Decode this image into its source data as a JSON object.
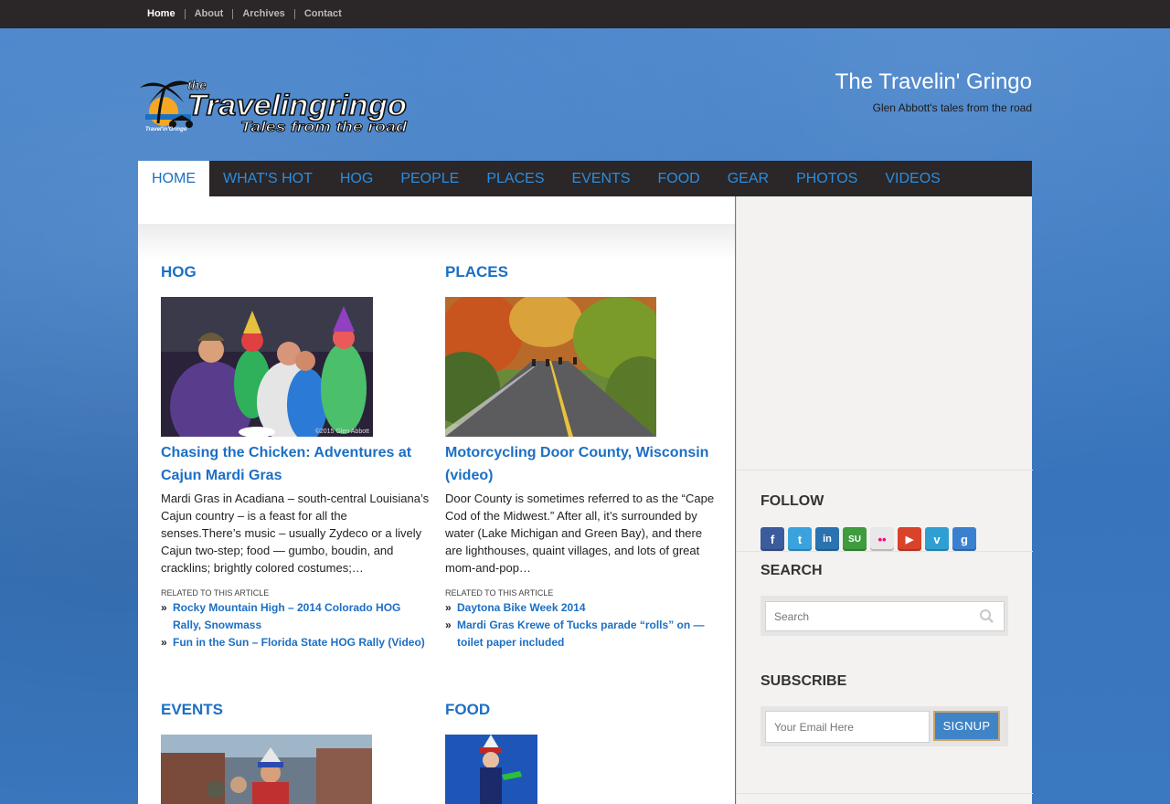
{
  "topnav": {
    "items": [
      {
        "label": "Home",
        "active": true
      },
      {
        "label": "About"
      },
      {
        "label": "Archives"
      },
      {
        "label": "Contact"
      }
    ]
  },
  "header": {
    "logo_text": "the Travelingringo Tales from the road",
    "title": "The Travelin' Gringo",
    "tagline": "Glen Abbott's tales from the road"
  },
  "mainnav": {
    "items": [
      "HOME",
      "WHAT'S HOT",
      "HOG",
      "PEOPLE",
      "PLACES",
      "EVENTS",
      "FOOD",
      "GEAR",
      "PHOTOS",
      "VIDEOS"
    ]
  },
  "sections": [
    {
      "category": "HOG",
      "post_title": "Chasing the Chicken: Adventures at Cajun Mardi Gras",
      "excerpt": "Mardi Gras in Acadiana – south-central Louisiana’s Cajun country – is a feast for all the senses.There’s music – usually Zydeco or a lively Cajun two-step; food — gumbo, boudin, and cracklins; brightly colored costumes;…",
      "image_caption": "©2015 Glen Abbott",
      "related_label": "RELATED TO THIS ARTICLE",
      "related": [
        "Rocky Mountain High – 2014 Colorado HOG Rally, Snowmass",
        "Fun in the Sun – Florida State HOG Rally (Video)"
      ]
    },
    {
      "category": "PLACES",
      "post_title": "Motorcycling Door County, Wisconsin (video)",
      "excerpt": "Door County is sometimes referred to as the “Cape Cod of the Midwest.” After all, it’s surrounded by water (Lake Michigan and Green Bay), and there are lighthouses, quaint villages, and lots of great mom-and-pop…",
      "related_label": "RELATED TO THIS ARTICLE",
      "related": [
        "Daytona Bike Week 2014",
        "Mardi Gras Krewe of Tucks parade “rolls” on — toilet paper included"
      ]
    },
    {
      "category": "EVENTS"
    },
    {
      "category": "FOOD"
    }
  ],
  "sidebar": {
    "follow_heading": "FOLLOW",
    "social": [
      {
        "icon": "facebook-icon",
        "glyph": "f",
        "color": "#3b5b9c"
      },
      {
        "icon": "twitter-icon",
        "glyph": "t",
        "color": "#3aa2dc"
      },
      {
        "icon": "linkedin-icon",
        "glyph": "in",
        "color": "#2a73b0"
      },
      {
        "icon": "stumbleupon-icon",
        "glyph": "SU",
        "color": "#3e9b3e"
      },
      {
        "icon": "flickr-icon",
        "glyph": "••",
        "color": "#e8e8e8"
      },
      {
        "icon": "youtube-icon",
        "glyph": "▶",
        "color": "#d9432b"
      },
      {
        "icon": "vimeo-icon",
        "glyph": "v",
        "color": "#2f9fd3"
      },
      {
        "icon": "google-icon",
        "glyph": "g",
        "color": "#3b7fd0"
      }
    ],
    "search_heading": "SEARCH",
    "search_placeholder": "Search",
    "subscribe_heading": "SUBSCRIBE",
    "email_placeholder": "Your Email Here",
    "signup_label": "SIGNUP"
  }
}
